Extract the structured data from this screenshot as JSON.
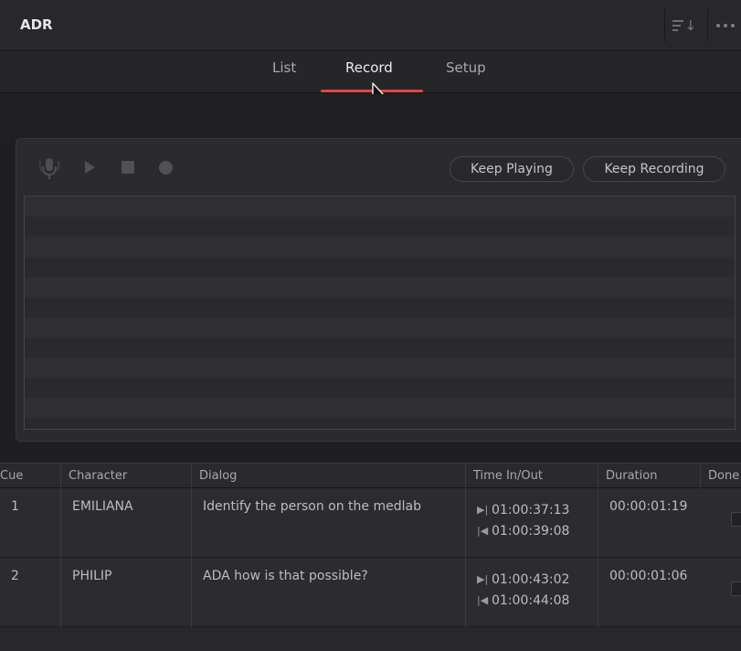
{
  "window": {
    "title": "ADR",
    "sort_icon": "sort-icon",
    "more_icon": "more-options-icon"
  },
  "tabs": [
    {
      "label": "List",
      "active": false
    },
    {
      "label": "Record",
      "active": true
    },
    {
      "label": "Setup",
      "active": false
    }
  ],
  "accent_color": "#e04545",
  "transport": {
    "icons": [
      "microphone-icon",
      "play-icon",
      "stop-icon",
      "record-icon"
    ],
    "keep_playing_label": "Keep Playing",
    "keep_recording_label": "Keep Recording"
  },
  "table": {
    "columns": [
      "Cue",
      "Character",
      "Dialog",
      "Time In/Out",
      "Duration",
      "Done"
    ],
    "rows": [
      {
        "cue": "1",
        "character": "EMILIANA",
        "dialog": "Identify the person on the medlab",
        "time_in": "01:00:37:13",
        "time_out": "01:00:39:08",
        "duration": "00:00:01:19"
      },
      {
        "cue": "2",
        "character": "PHILIP",
        "dialog": "ADA how is that possible?",
        "time_in": "01:00:43:02",
        "time_out": "01:00:44:08",
        "duration": "00:00:01:06"
      }
    ]
  }
}
